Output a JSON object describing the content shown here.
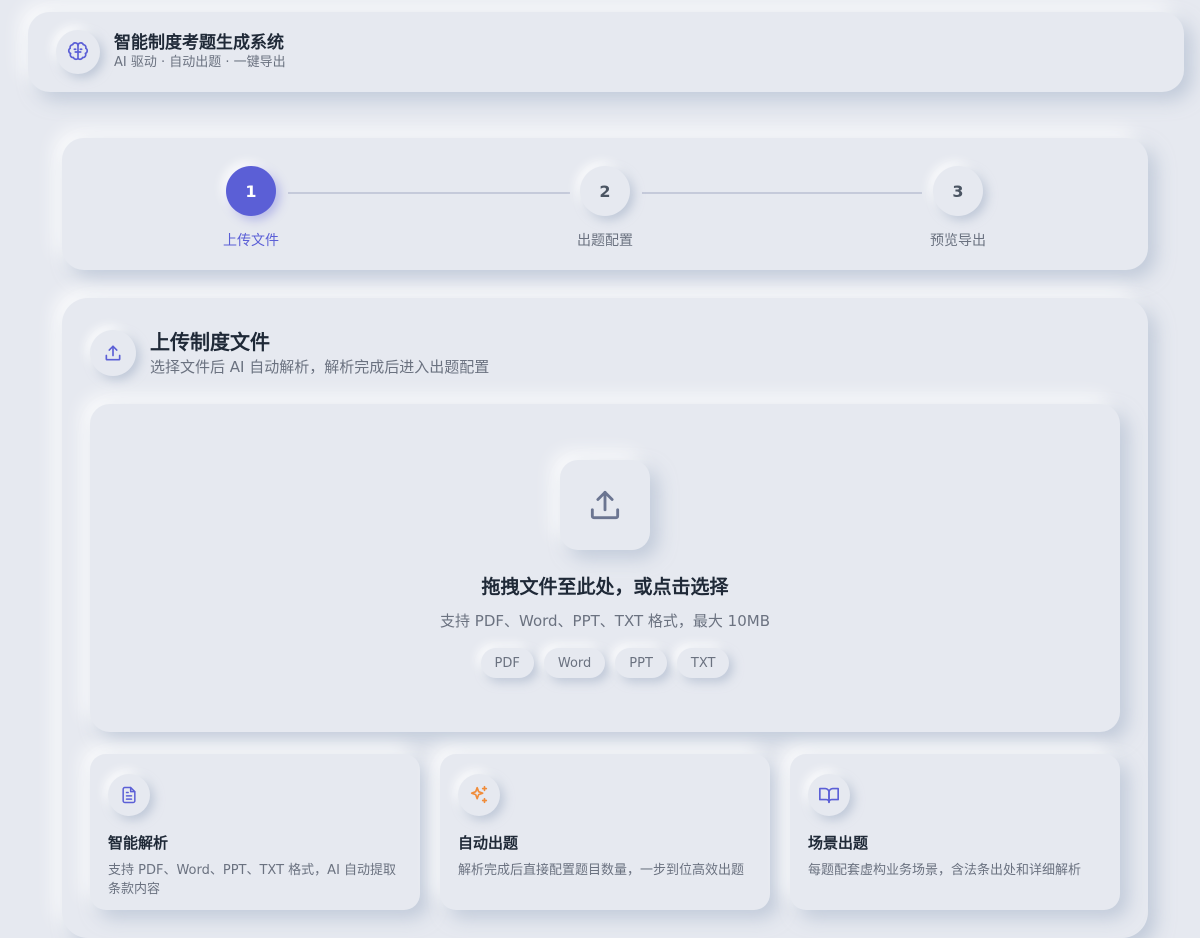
{
  "header": {
    "title": "智能制度考题生成系统",
    "subtitle": "AI 驱动 · 自动出题 · 一键导出",
    "logo_icon": "brain-icon"
  },
  "steps": [
    {
      "number": "1",
      "label": "上传文件",
      "active": true
    },
    {
      "number": "2",
      "label": "出题配置",
      "active": false
    },
    {
      "number": "3",
      "label": "预览导出",
      "active": false
    }
  ],
  "upload": {
    "title": "上传制度文件",
    "subtitle": "选择文件后 AI 自动解析，解析完成后进入出题配置",
    "icon": "upload-icon"
  },
  "dropzone": {
    "title": "拖拽文件至此处，或点击选择",
    "subtitle": "支持 PDF、Word、PPT、TXT 格式，最大 10MB",
    "icon": "upload-icon",
    "formats": [
      "PDF",
      "Word",
      "PPT",
      "TXT"
    ]
  },
  "features": [
    {
      "title": "智能解析",
      "desc": "支持 PDF、Word、PPT、TXT 格式，AI 自动提取条款内容",
      "icon": "document-icon",
      "color": "#5b5fd6"
    },
    {
      "title": "自动出题",
      "desc": "解析完成后直接配置题目数量，一步到位高效出题",
      "icon": "sparkles-icon",
      "color": "#f08c3a"
    },
    {
      "title": "场景出题",
      "desc": "每题配套虚构业务场景，含法条出处和详细解析",
      "icon": "book-icon",
      "color": "#5b5fd6"
    }
  ],
  "colors": {
    "accent": "#5b5fd6",
    "background": "#e6e9f0",
    "orange": "#f08c3a"
  }
}
